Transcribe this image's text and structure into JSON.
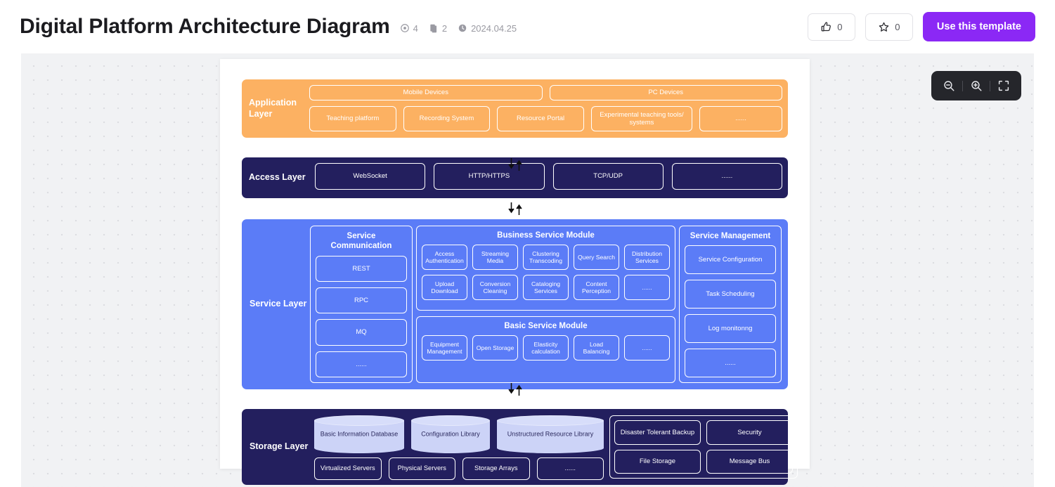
{
  "header": {
    "title": "Digital Platform Architecture Diagram",
    "meta": [
      {
        "icon": "eye-icon",
        "value": "4"
      },
      {
        "icon": "copies-icon",
        "value": "2"
      },
      {
        "icon": "clock-icon",
        "value": "2024.04.25"
      }
    ],
    "like": {
      "icon": "thumbs-up-icon",
      "count": "0"
    },
    "favorite": {
      "icon": "star-icon",
      "count": "0"
    },
    "use_template_label": "Use this template"
  },
  "canvas": {
    "zoom_controls": [
      {
        "name": "zoom-out-icon",
        "label": "Zoom out"
      },
      {
        "name": "zoom-in-icon",
        "label": "Zoom in"
      },
      {
        "name": "fit-screen-icon",
        "label": "Fit to screen"
      }
    ]
  },
  "colors": {
    "application_layer": "#FCB162",
    "access_layer": "#231F5E",
    "service_layer": "#5B7CF7",
    "storage_layer": "#231F5E",
    "cylinder": "#CCD3F7",
    "accent_purple": "#8B28F5",
    "canvas_bg": "#F1F2F4"
  },
  "diagram": {
    "application_layer": {
      "label": "Application\nLayer",
      "devices": [
        "Mobile Devices",
        "PC Devices"
      ],
      "apps": [
        "Teaching platform",
        "Recording System",
        "Resource Portal",
        "Experimental teaching tools/ systems",
        "......"
      ]
    },
    "access_layer": {
      "label": "Access Layer",
      "protocols": [
        "WebSocket",
        "HTTP/HTTPS",
        "TCP/UDP",
        "......"
      ]
    },
    "service_layer": {
      "label": "Service Layer",
      "service_communication": {
        "title": "Service Communication",
        "items": [
          "REST",
          "RPC",
          "MQ",
          "......"
        ]
      },
      "business_service_module": {
        "title": "Business Service Module",
        "row1": [
          "Access Authentication",
          "Streaming Media",
          "Clustering Transcoding",
          "Query Search",
          "Distribution Services"
        ],
        "row2": [
          "Upload Download",
          "Conversion Cleaning",
          "Cataloging Services",
          "Content Perception",
          "......"
        ]
      },
      "basic_service_module": {
        "title": "Basic Service Module",
        "items": [
          "Equipment Management",
          "Open Storage",
          "Elasticity calculation",
          "Load Balancing",
          "......"
        ]
      },
      "service_management": {
        "title": "Service Management",
        "items": [
          "Service Configuration",
          "Task Scheduling",
          "Log monitonng",
          "......"
        ]
      }
    },
    "storage_layer": {
      "label": "Storage Layer",
      "databases": [
        "Basic Information Database",
        "Configuration Library",
        "Unstructured Resource Library"
      ],
      "infrastructure": [
        "Virtualized Servers",
        "Physical Servers",
        "Storage Arrays",
        "......"
      ],
      "services": [
        [
          "Disaster Tolerant Backup",
          "Security"
        ],
        [
          "File Storage",
          "Message Bus"
        ]
      ]
    }
  }
}
